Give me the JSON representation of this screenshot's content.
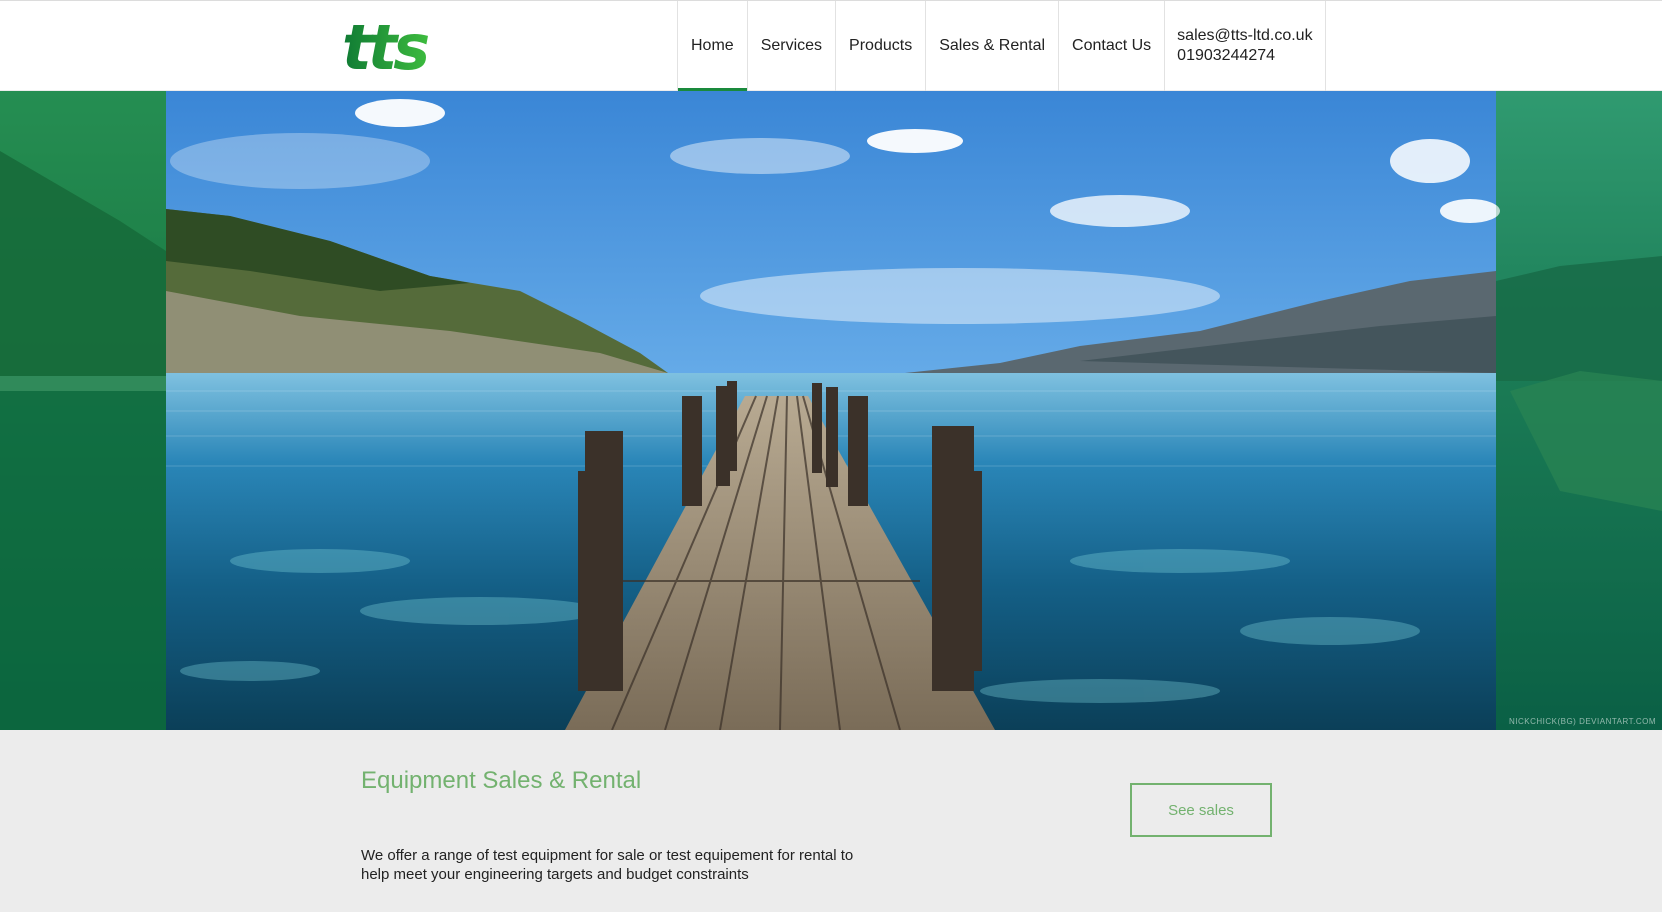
{
  "header": {
    "logo_text": "tts",
    "nav": [
      {
        "label": "Home",
        "active": true
      },
      {
        "label": "Services",
        "active": false
      },
      {
        "label": "Products",
        "active": false
      },
      {
        "label": "Sales & Rental",
        "active": false
      },
      {
        "label": "Contact Us",
        "active": false
      }
    ],
    "contact": {
      "email": "sales@tts-ltd.co.uk",
      "phone": "01903244274"
    }
  },
  "hero": {
    "watermark": "NICKCHICK(BG) DEVIANTART.COM"
  },
  "content": {
    "title": "Equipment Sales & Rental",
    "body": "We offer a range of test equipment for sale or test equipement for rental to help meet your engineering targets and budget constraints",
    "button_label": "See sales"
  },
  "colors": {
    "accent_green": "#73b26f",
    "brand_green": "#1a8a3c",
    "page_background": "#ececec"
  }
}
